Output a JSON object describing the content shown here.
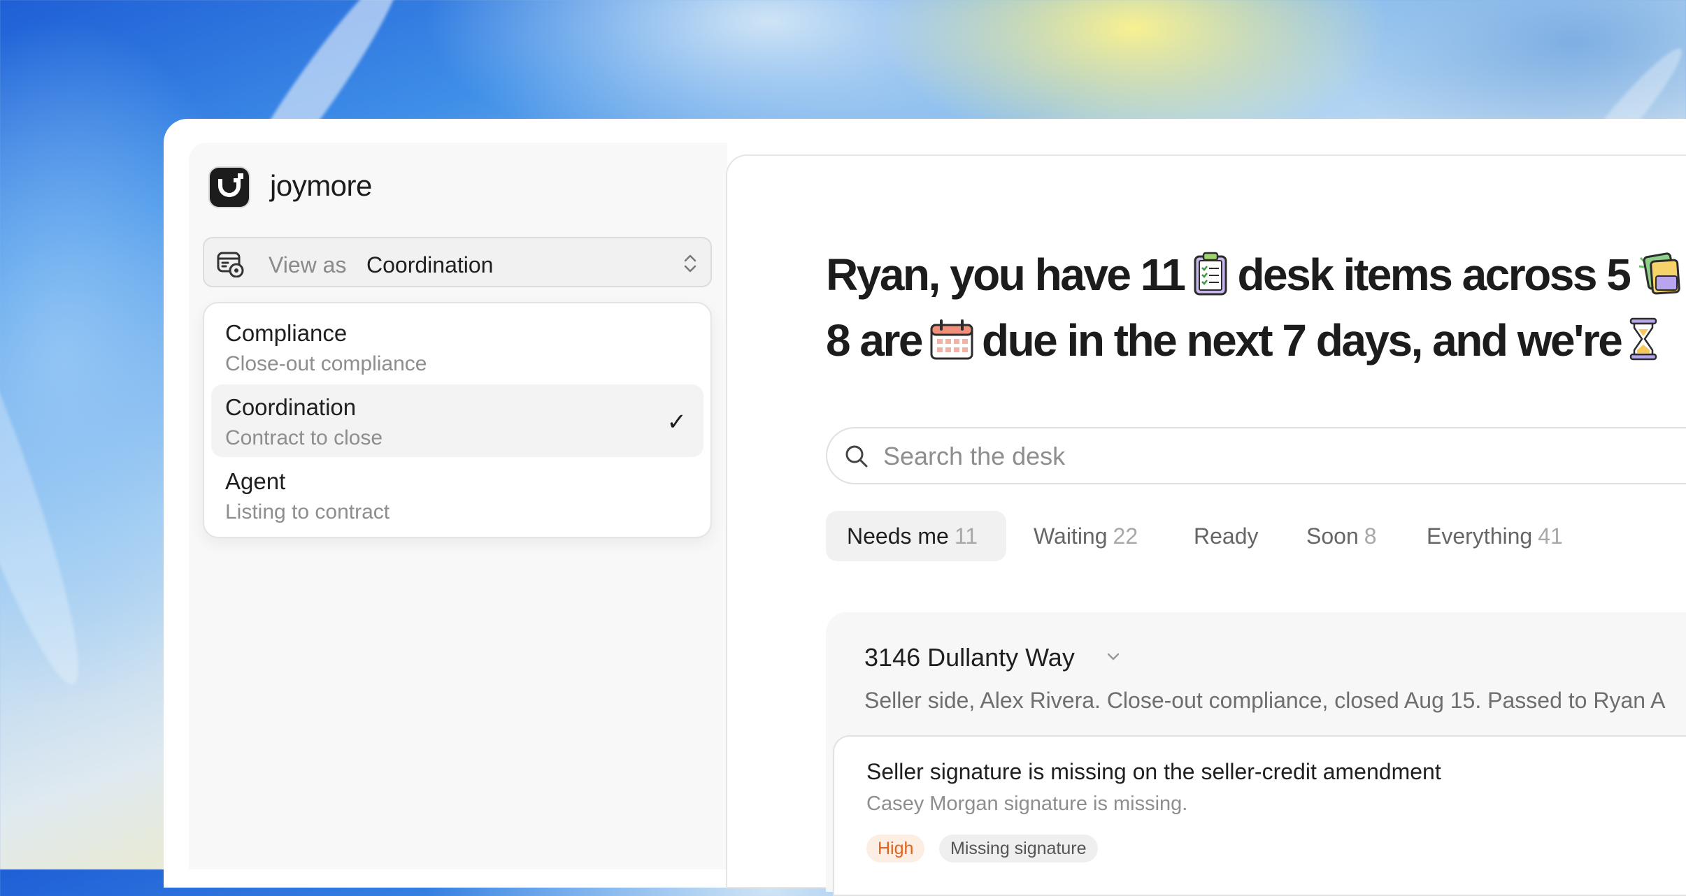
{
  "brand": {
    "name": "joymore"
  },
  "view_as": {
    "label": "View as",
    "value": "Coordination"
  },
  "view_menu": {
    "options": [
      {
        "title": "Compliance",
        "subtitle": "Close-out compliance",
        "selected": false
      },
      {
        "title": "Coordination",
        "subtitle": "Contract to close",
        "selected": true
      },
      {
        "title": "Agent",
        "subtitle": "Listing to contract",
        "selected": false
      }
    ],
    "check_glyph": "✓"
  },
  "headline": {
    "line1_a": "Ryan, you have 11",
    "line1_b": "desk items across 5",
    "line2_a": "8 are",
    "line2_b": "due in the next 7 days, and we're",
    "emojis": [
      "clipboard-emoji",
      "documents-emoji",
      "calendar-emoji",
      "hourglass-emoji"
    ]
  },
  "search": {
    "placeholder": "Search the desk"
  },
  "tabs": [
    {
      "label": "Needs me",
      "count": "11",
      "active": true
    },
    {
      "label": "Waiting",
      "count": "22",
      "active": false
    },
    {
      "label": "Ready",
      "count": "",
      "active": false
    },
    {
      "label": "Soon",
      "count": "8",
      "active": false
    },
    {
      "label": "Everything",
      "count": "41",
      "active": false
    }
  ],
  "property": {
    "title": "3146 Dullanty Way",
    "description": "Seller side, Alex Rivera. Close-out compliance, closed Aug 15. Passed to Ryan A",
    "items": [
      {
        "title": "Seller signature is missing on the seller-credit amendment",
        "subtitle": "Casey Morgan signature is missing.",
        "priority": "High",
        "type": "Missing signature"
      }
    ]
  },
  "colors": {
    "priority_high_bg": "#fdeee3",
    "priority_high_text": "#e0621e",
    "accent_dark": "#1c1c1c"
  }
}
